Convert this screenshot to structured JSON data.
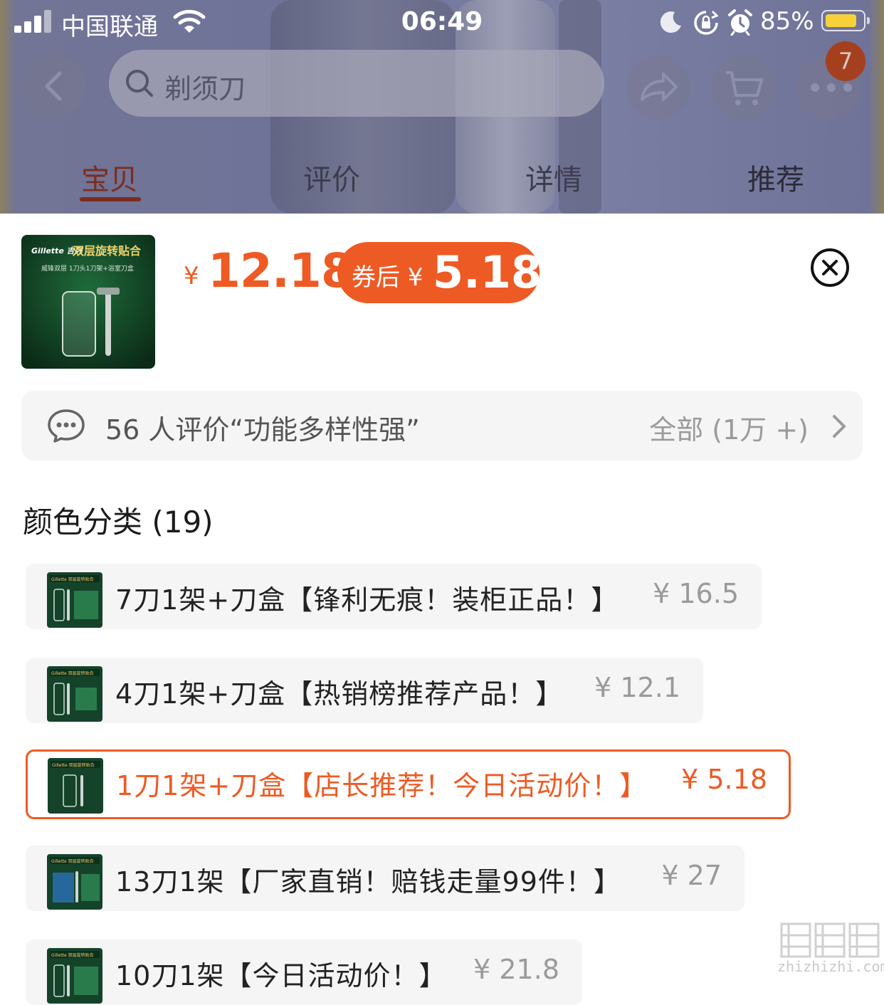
{
  "status_bar": {
    "carrier": "中国联通",
    "time": "06:49",
    "battery_percent": "85%",
    "battery_level": 0.85,
    "battery_color": "#f7d13a",
    "icons": [
      "signal-icon",
      "wifi-icon",
      "moon-icon",
      "rotation-lock-icon",
      "alarm-icon",
      "battery-icon"
    ]
  },
  "header": {
    "search_text": "剃须刀",
    "cart_badge": "7",
    "tabs": [
      {
        "label": "宝贝",
        "active": true
      },
      {
        "label": "评价",
        "active": false
      },
      {
        "label": "详情",
        "active": false
      },
      {
        "label": "推荐",
        "active": false
      }
    ]
  },
  "product": {
    "thumb_brand": "Gillette 吉列",
    "thumb_title": "双层旋转贴合",
    "thumb_subtitle": "威锋双层 1刀头1刀架+浴室刀盒",
    "price_symbol": "¥",
    "price": "12.18",
    "coupon_label": "券后 ¥",
    "coupon_price": "5.18"
  },
  "review_bar": {
    "text": "56 人评价“功能多样性强”",
    "all_label": "全部 (1万 +)"
  },
  "section": {
    "title": "颜色分类 (19)"
  },
  "options": [
    {
      "name": "7刀1架+刀盒【锋利无痕！装柜正品！】",
      "price": "¥ 16.5",
      "selected": false
    },
    {
      "name": "4刀1架+刀盒【热销榜推荐产品！】",
      "price": "¥ 12.1",
      "selected": false
    },
    {
      "name": "1刀1架+刀盒【店长推荐！今日活动价！】",
      "price": "¥ 5.18",
      "selected": true
    },
    {
      "name": "13刀1架【厂家直销！赔钱走量99件！】",
      "price": "¥ 27",
      "selected": false
    },
    {
      "name": "10刀1架【今日活动价！】",
      "price": "¥ 21.8",
      "selected": false
    }
  ],
  "accent_color": "#ee5a24",
  "watermark": "zhizhizhi.com"
}
